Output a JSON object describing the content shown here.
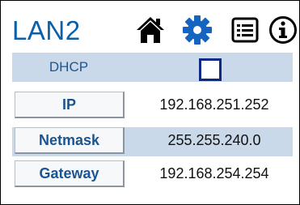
{
  "header": {
    "title": "LAN2",
    "title_color": "#0d5fa8",
    "icons": [
      "home-icon",
      "gear-icon",
      "list-icon",
      "info-icon"
    ],
    "accent_color": "#1565c0"
  },
  "rows": {
    "dhcp": {
      "label": "DHCP",
      "checked": false
    },
    "ip": {
      "label": "IP",
      "value": "192.168.251.252"
    },
    "netmask": {
      "label": "Netmask",
      "value": "255.255.240.0"
    },
    "gateway": {
      "label": "Gateway",
      "value": "192.168.254.254"
    }
  },
  "colors": {
    "row_shade": "#c9d9ea",
    "label_text": "#1a5592",
    "checkbox_border": "#0e2a86"
  }
}
